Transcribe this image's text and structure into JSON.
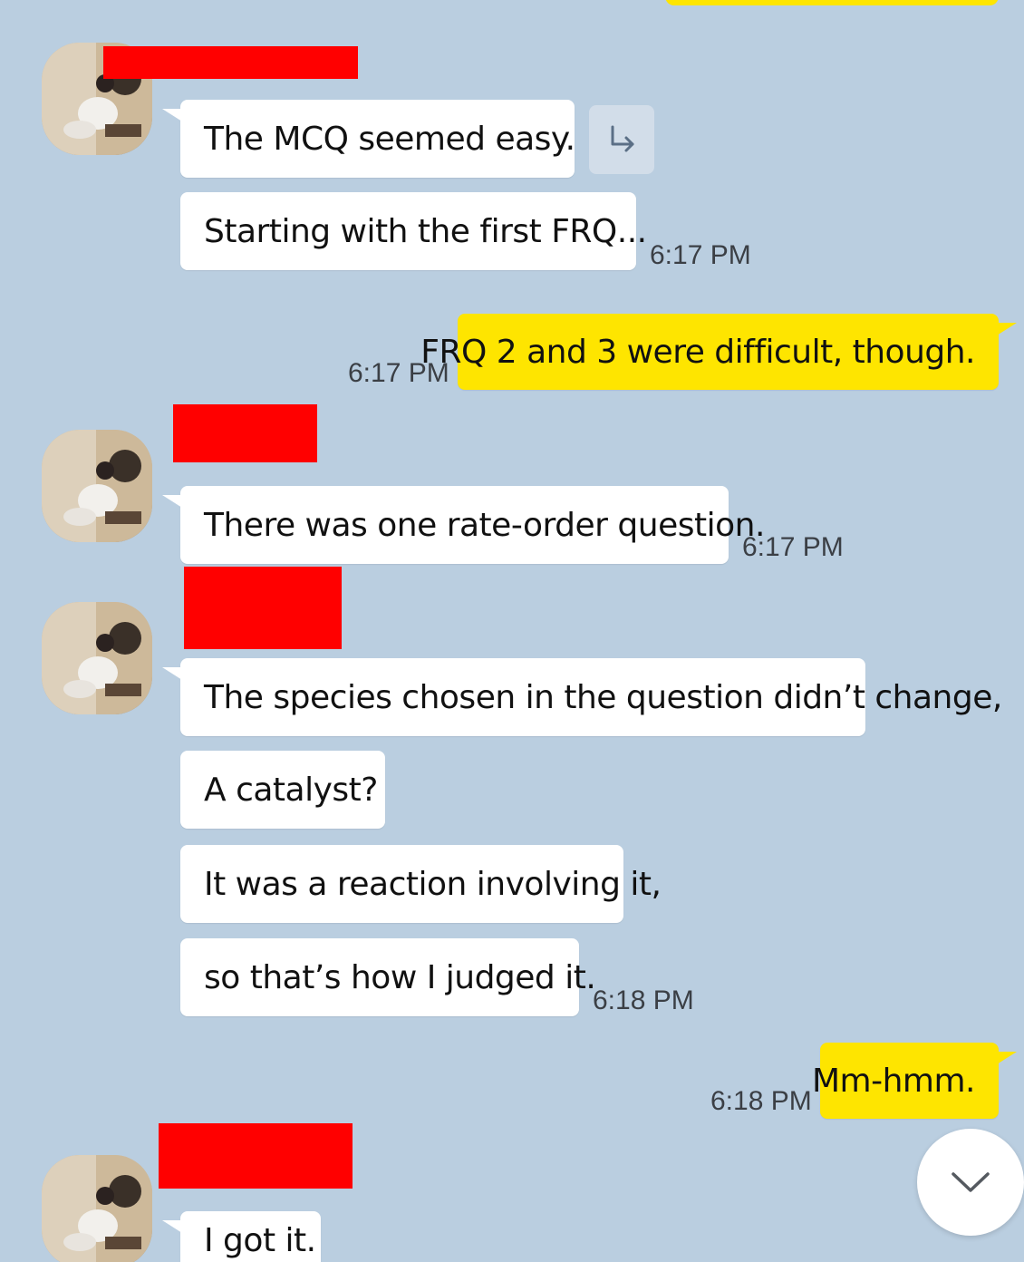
{
  "colors": {
    "background": "#bacee0",
    "incoming_bubble": "#ffffff",
    "outgoing_bubble": "#fee500",
    "redaction": "#ff0000"
  },
  "messages": {
    "m1": {
      "text": "The MCQ seemed easy."
    },
    "m2": {
      "text": "Starting with the first FRQ...",
      "time": "6:17 PM"
    },
    "m3": {
      "text": "FRQ 2 and 3 were difficult, though.",
      "time": "6:17 PM"
    },
    "m4": {
      "text": "There was one rate-order question.",
      "time": "6:17 PM"
    },
    "m5": {
      "text": "The species chosen in the question didn’t change,"
    },
    "m6": {
      "text": "A catalyst?"
    },
    "m7": {
      "text": "It was a reaction involving it,"
    },
    "m8": {
      "text": "so that’s how I judged it.",
      "time": "6:18 PM"
    },
    "m9": {
      "text": "Mm-hmm.",
      "time": "6:18 PM"
    },
    "m10": {
      "text": "I got it."
    }
  },
  "icons": {
    "reply": "reply-arrow-icon",
    "scroll_down": "chevron-down-icon",
    "avatar": "profile-photo"
  }
}
